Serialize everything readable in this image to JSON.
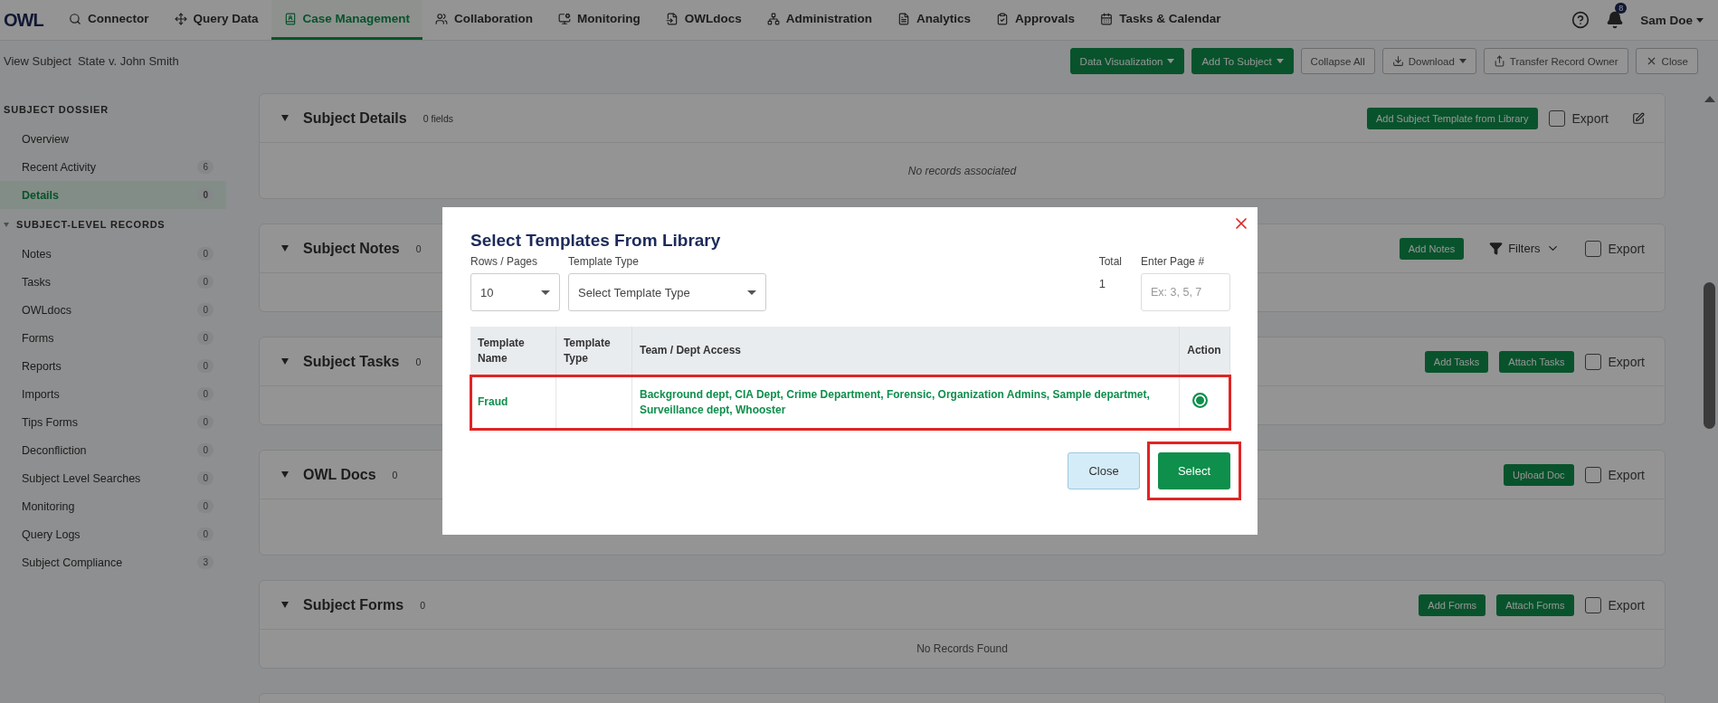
{
  "nav": {
    "logo": "OWL",
    "items": [
      {
        "label": "Connector",
        "selected": false
      },
      {
        "label": "Query Data",
        "selected": false
      },
      {
        "label": "Case Management",
        "selected": true
      },
      {
        "label": "Collaboration",
        "selected": false
      },
      {
        "label": "Monitoring",
        "selected": false
      },
      {
        "label": "OWLdocs",
        "selected": false
      },
      {
        "label": "Administration",
        "selected": false
      },
      {
        "label": "Analytics",
        "selected": false
      },
      {
        "label": "Approvals",
        "selected": false
      },
      {
        "label": "Tasks & Calendar",
        "selected": false
      }
    ],
    "notification_count": "8",
    "user": "Sam Doe"
  },
  "breadcrumb": {
    "label": "View Subject",
    "subject": "State v. John Smith"
  },
  "toolbar": [
    {
      "label": "Data Visualization",
      "kind": "primary",
      "dropdown": true
    },
    {
      "label": "Add To Subject",
      "kind": "primary",
      "dropdown": true
    },
    {
      "label": "Collapse All",
      "kind": "outline",
      "dropdown": false
    },
    {
      "label": "Download",
      "kind": "outline",
      "dropdown": true
    },
    {
      "label": "Transfer Record Owner",
      "kind": "outline",
      "dropdown": false
    },
    {
      "label": "Close",
      "kind": "outline",
      "dropdown": false
    }
  ],
  "sidebar": {
    "sections": [
      {
        "title": "SUBJECT DOSSIER",
        "kind": "plain",
        "items": [
          {
            "label": "Overview",
            "selected": false
          },
          {
            "label": "Recent Activity",
            "count": "6",
            "selected": false
          },
          {
            "label": "Details",
            "count": "0",
            "selected": true
          }
        ]
      },
      {
        "title": "SUBJECT-LEVEL RECORDS",
        "kind": "collapsible",
        "expanded": true,
        "items": [
          {
            "label": "Notes",
            "count": "0",
            "selected": false
          },
          {
            "label": "Tasks",
            "count": "0",
            "selected": false
          },
          {
            "label": "OWLdocs",
            "count": "0",
            "selected": false
          },
          {
            "label": "Forms",
            "count": "0",
            "selected": false
          },
          {
            "label": "Reports",
            "count": "0",
            "selected": false
          },
          {
            "label": "Imports",
            "count": "0",
            "selected": false
          },
          {
            "label": "Tips Forms",
            "count": "0",
            "selected": false
          },
          {
            "label": "Deconfliction",
            "count": "0",
            "selected": false
          },
          {
            "label": "Subject Level Searches",
            "count": "0",
            "selected": false
          },
          {
            "label": "Monitoring",
            "count": "0",
            "selected": false
          },
          {
            "label": "Query Logs",
            "count": "0",
            "selected": false
          },
          {
            "label": "Subject Compliance",
            "count": "3",
            "selected": false
          }
        ]
      }
    ]
  },
  "cards": [
    {
      "title": "Subject Details",
      "count": "0 fields",
      "buttons": [
        "Add Subject Template from Library"
      ],
      "export_label": "Export",
      "export_checked": false,
      "editable": true,
      "tall": true,
      "empty_text": "No records associated",
      "empty_italic": true
    },
    {
      "title": "Subject Notes",
      "count": "0",
      "buttons": [
        "Add Notes"
      ],
      "filter": "Filters",
      "export_label": "Export",
      "export_checked": false,
      "editable": false,
      "tall": false
    },
    {
      "title": "Subject Tasks",
      "count": "0",
      "buttons": [
        "Add Tasks",
        "Attach Tasks"
      ],
      "export_label": "Export",
      "export_checked": false,
      "editable": false,
      "tall": false
    },
    {
      "title": "OWL Docs",
      "count": "0",
      "buttons": [
        "Upload Doc"
      ],
      "export_label": "Export",
      "export_checked": false,
      "editable": false,
      "tall": true
    },
    {
      "title": "Subject Forms",
      "count": "0",
      "buttons": [
        "Add Forms",
        "Attach Forms"
      ],
      "export_label": "Export",
      "export_checked": false,
      "editable": false,
      "tall": false,
      "empty_text": "No Records Found",
      "empty_italic": false
    }
  ],
  "modal": {
    "title": "Select Templates From Library",
    "rows_per_page": {
      "label": "Rows / Pages",
      "value": "10"
    },
    "template_type": {
      "label": "Template Type",
      "placeholder": "Select Template Type"
    },
    "total": {
      "label": "Total",
      "value": "1"
    },
    "page": {
      "label": "Enter Page #",
      "placeholder": "Ex: 3, 5, 7"
    },
    "table": {
      "columns": [
        "Template Name",
        "Template Type",
        "Team / Dept Access",
        "Action"
      ],
      "rows": [
        {
          "name": "Fraud",
          "access": "Background dept, CIA Dept, Crime Department, Forensic, Organization Admins, Sample departmet, Surveillance dept, Whooster",
          "selected": true,
          "highlighted": true
        }
      ]
    },
    "buttons": [
      {
        "label": "Close",
        "kind": "secondary",
        "highlighted": false
      },
      {
        "label": "Select",
        "kind": "primary",
        "highlighted": true
      }
    ]
  }
}
